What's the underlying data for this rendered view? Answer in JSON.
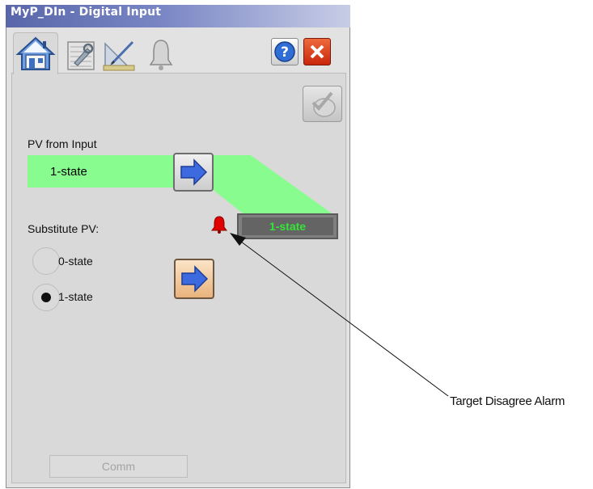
{
  "window": {
    "title": "MyP_DIn - Digital Input"
  },
  "tabs": [
    {
      "icon": "home-icon",
      "active": true
    },
    {
      "icon": "maintenance-icon",
      "active": false
    },
    {
      "icon": "engineering-icon",
      "active": false
    },
    {
      "icon": "alarm-bell-icon",
      "active": false
    }
  ],
  "header_buttons": {
    "help_icon": "help-icon",
    "close_icon": "close-icon"
  },
  "colors": {
    "pv_bar": "#88fc8f",
    "output_text": "#34e537",
    "alarm": "#e00000"
  },
  "pv": {
    "label": "PV from Input",
    "value": "1-state"
  },
  "output": {
    "value": "1-state"
  },
  "substitute": {
    "label": "Substitute PV:",
    "options": [
      {
        "label": "0-state",
        "selected": false
      },
      {
        "label": "1-state",
        "selected": true
      }
    ]
  },
  "status": {
    "comm_label": "Comm"
  },
  "annotation": {
    "callout": "Target Disagree Alarm"
  }
}
